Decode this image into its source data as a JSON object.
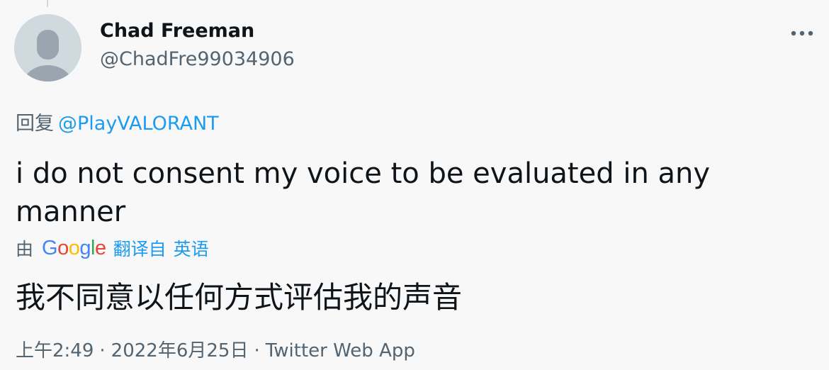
{
  "tweet": {
    "author_name": "Chad Freeman",
    "author_handle": "@ChadFre99034906",
    "more_icon": "more-horizontal-icon",
    "avatar_icon": "default-avatar-icon",
    "reply_prefix": "回复",
    "reply_to": "@PlayVALORANT",
    "text": "i do not consent my voice to be evaluated in any manner",
    "translation": {
      "by_label": "由",
      "provider": {
        "letters": [
          "G",
          "o",
          "o",
          "g",
          "l",
          "e"
        ],
        "colors": [
          "#4285f4",
          "#ea4335",
          "#fbbc05",
          "#4285f4",
          "#34a853",
          "#ea4335"
        ]
      },
      "from_label": "翻译自",
      "source_language": "英语",
      "translated_text": "我不同意以任何方式评估我的声音"
    },
    "meta": {
      "time": "上午2:49",
      "separator": "·",
      "date": "2022年6月25日",
      "source": "Twitter Web App"
    }
  },
  "colors": {
    "background": "#f8f8f9",
    "text_primary": "#0f1419",
    "text_secondary": "#536471",
    "link": "#1d9bf0",
    "avatar_bg": "#cfd9de",
    "avatar_fg": "#9aa5b0"
  }
}
